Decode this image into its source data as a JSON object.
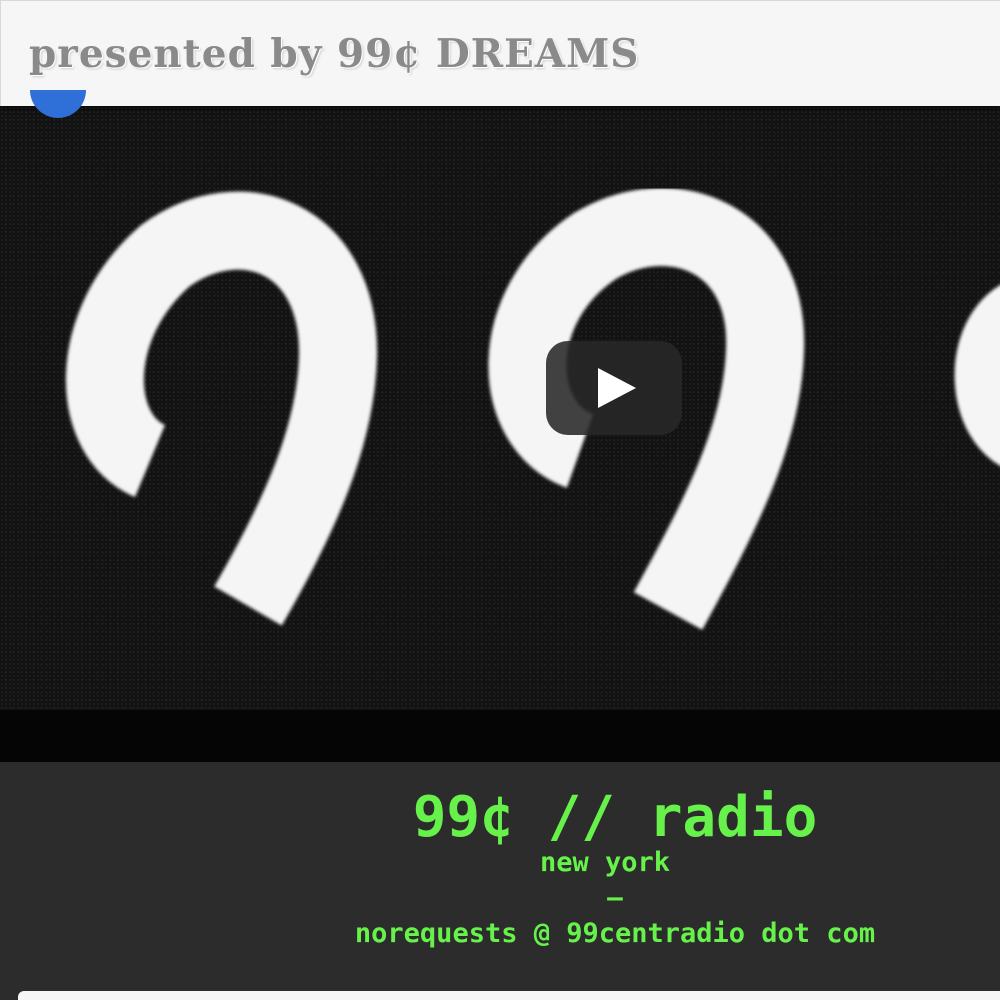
{
  "header": {
    "title": "presented by 99¢ DREAMS"
  },
  "video": {
    "play_button_icon": "play-icon",
    "accent_color": "#2f6fd8"
  },
  "station": {
    "title": "99¢ // radio",
    "city": "new york",
    "separator": "—",
    "email": "norequests @ 99centradio dot com",
    "text_color": "#66f24a"
  }
}
